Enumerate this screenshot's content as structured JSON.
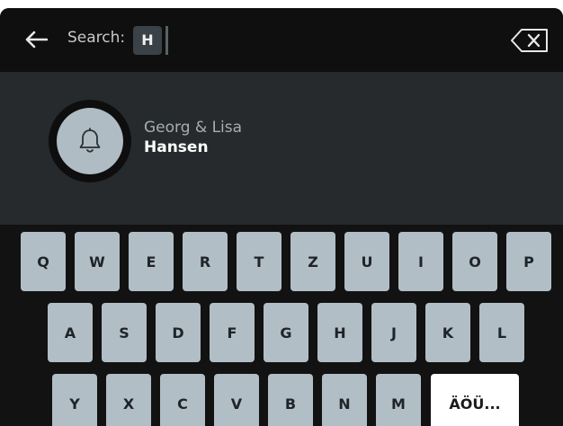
{
  "search": {
    "label": "Search:",
    "query": "H"
  },
  "result": {
    "first_names": "Georg & Lisa",
    "last_name": "Hansen",
    "icon": "bell-icon"
  },
  "keyboard": {
    "row1": [
      "Q",
      "W",
      "E",
      "R",
      "T",
      "Z",
      "U",
      "I",
      "O",
      "P"
    ],
    "row2": [
      "A",
      "S",
      "D",
      "F",
      "G",
      "H",
      "J",
      "K",
      "L"
    ],
    "row3": [
      "Y",
      "X",
      "C",
      "V",
      "B",
      "N",
      "M"
    ],
    "special_label": "ÄÖÜ..."
  },
  "colors": {
    "key": "#b2bec6",
    "special_key": "#ffffff",
    "background": "#131313",
    "result_panel": "#262a2c"
  }
}
